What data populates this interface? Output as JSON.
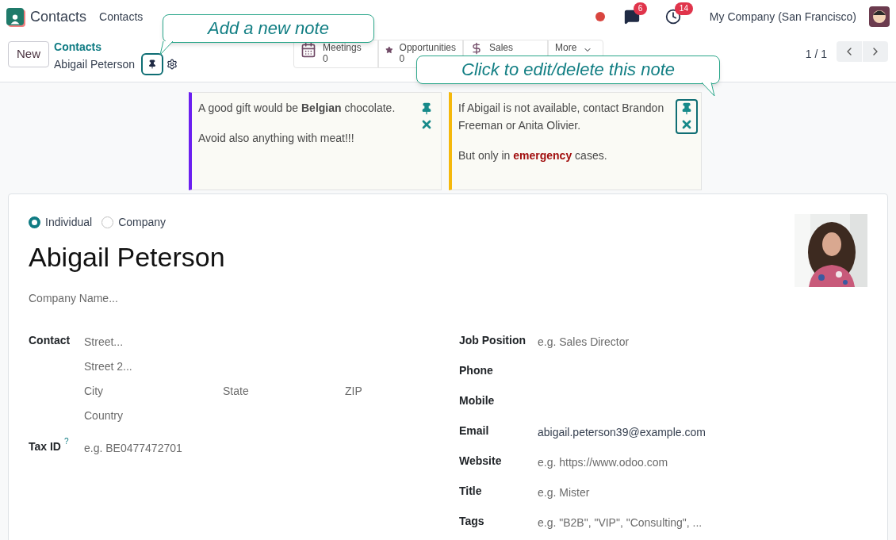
{
  "navbar": {
    "app_name": "Contacts",
    "menu": [
      "Contacts"
    ],
    "chat_badge": "6",
    "activity_badge": "14",
    "company": "My Company (San Francisco)"
  },
  "control_panel": {
    "new_button": "New",
    "breadcrumb": "Contacts",
    "record_name": "Abigail Peterson",
    "pager": "1 / 1",
    "smart_buttons": [
      {
        "kind": "calendar",
        "label": "Meetings",
        "count": "0"
      },
      {
        "kind": "star",
        "label": "Opportunities",
        "count": "0"
      },
      {
        "kind": "dollar",
        "label": "Sales"
      },
      {
        "kind": "more",
        "label": "More"
      }
    ]
  },
  "callouts": [
    {
      "text": "Add a new note"
    },
    {
      "text": "Click to edit/delete this note"
    }
  ],
  "notes": [
    {
      "color": "#6b1ff0",
      "highlighted": false,
      "paragraphs": [
        [
          {
            "text": "A good gift would be "
          },
          {
            "text": "Belgian",
            "kind": "bold"
          },
          {
            "text": " chocolate."
          }
        ],
        [
          {
            "text": "Avoid also anything with meat!!!"
          }
        ]
      ]
    },
    {
      "color": "#f5b80c",
      "highlighted": true,
      "paragraphs": [
        [
          {
            "text": "If Abigail is not available, contact Brandon Freeman or Anita Olivier."
          }
        ],
        [
          {
            "text": "But only in "
          },
          {
            "text": "emergency",
            "kind": "alert"
          },
          {
            "text": " cases."
          }
        ]
      ]
    }
  ],
  "form": {
    "company_type": [
      {
        "label": "Individual",
        "selected": true
      },
      {
        "label": "Company",
        "selected": false
      }
    ],
    "name": "Abigail Peterson",
    "company_placeholder": "Company Name...",
    "address": {
      "label": "Contact",
      "street": "Street...",
      "street2": "Street 2...",
      "city": "City",
      "state": "State",
      "zip": "ZIP",
      "country": "Country"
    },
    "tax_id": {
      "label": "Tax ID",
      "help": "?",
      "placeholder": "e.g. BE0477472701"
    },
    "right_fields": [
      {
        "label": "Job Position",
        "placeholder": "e.g. Sales Director"
      },
      {
        "label": "Phone"
      },
      {
        "label": "Mobile"
      },
      {
        "label": "Email",
        "value": "abigail.peterson39@example.com"
      },
      {
        "label": "Website",
        "placeholder": "e.g. https://www.odoo.com"
      },
      {
        "label": "Title",
        "placeholder": "e.g. Mister"
      },
      {
        "label": "Tags",
        "placeholder": "e.g. \"B2B\", \"VIP\", \"Consulting\", ..."
      }
    ]
  }
}
